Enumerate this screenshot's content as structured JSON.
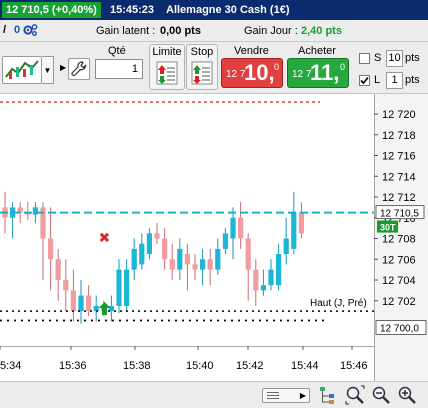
{
  "titlebar": {
    "price_change": "12 710,5 (+0,40%)",
    "time": "15:45:23",
    "instrument": "Allemagne 30 Cash (1€)",
    "colors": {
      "bar": "#0a2c6e",
      "price_pill": "#17a236"
    }
  },
  "infobar": {
    "slash": "/",
    "count": "0",
    "gear_icon": "gears-icon",
    "latent_label": "Gain latent :",
    "latent_value": "0,00 pts",
    "daily_label": "Gain Jour :",
    "daily_value": "2,40 pts",
    "daily_color": "#14a02a"
  },
  "toolbar": {
    "qty_label": "Qté",
    "qty_value": "1",
    "limit_label": "Limite",
    "stop_label": "Stop",
    "sell_label": "Vendre",
    "buy_label": "Acheter",
    "sell_small": "12 7",
    "sell_big": "10,",
    "sell_sup": "0",
    "buy_small": "12 7",
    "buy_big": "11,",
    "buy_sup": "0",
    "s_label": "S",
    "s_pts_value": "10",
    "s_pts_label": "pts",
    "l_label": "L",
    "l_pts_value": "1",
    "l_pts_label": "pts",
    "s_checked": false,
    "l_checked": true
  },
  "chart_data": {
    "type": "candlestick",
    "y_ticks": [
      "12 720",
      "12 718",
      "12 716",
      "12 714",
      "12 712",
      "12 710",
      "12 708",
      "12 706",
      "12 704",
      "12 702"
    ],
    "x_ticks": [
      "5:34",
      "15:36",
      "15:38",
      "15:40",
      "15:42",
      "15:44",
      "15:46"
    ],
    "current_price_label": "12 710,5",
    "timeframe_badge": "30T",
    "lower_price_label": "12 700,0",
    "annotation": "Haut (J, Pré)",
    "ylim": [
      12699.5,
      12721.5
    ],
    "colors": {
      "up": "#1bb6d8",
      "down": "#f09ca0",
      "price_line": "#16b3bf",
      "red_line": "#d42020",
      "badge": "#1a9a2c"
    },
    "levels": {
      "current": 12710.5,
      "red_dashed": 12722,
      "haut_dotted": 12701,
      "lower_dotted": 12700
    },
    "markers": [
      {
        "kind": "sell-x",
        "candle": 16,
        "y": 12708
      },
      {
        "kind": "buy-arrow",
        "candle": 16,
        "y": 12701.3
      }
    ],
    "candles": [
      {
        "o": 12711,
        "h": 12712.5,
        "l": 12708.5,
        "c": 12710
      },
      {
        "o": 12710,
        "h": 12711.5,
        "l": 12708,
        "c": 12711
      },
      {
        "o": 12711,
        "h": 12711.5,
        "l": 12709.5,
        "c": 12710.5
      },
      {
        "o": 12710.5,
        "h": 12711.5,
        "l": 12709.8,
        "c": 12710.3
      },
      {
        "o": 12710.3,
        "h": 12711.5,
        "l": 12709.5,
        "c": 12711
      },
      {
        "o": 12711,
        "h": 12711.5,
        "l": 12704,
        "c": 12708
      },
      {
        "o": 12708,
        "h": 12711,
        "l": 12703,
        "c": 12706
      },
      {
        "o": 12706,
        "h": 12707,
        "l": 12702,
        "c": 12704
      },
      {
        "o": 12704,
        "h": 12706,
        "l": 12701,
        "c": 12703
      },
      {
        "o": 12703,
        "h": 12705,
        "l": 12700,
        "c": 12701
      },
      {
        "o": 12701,
        "h": 12704,
        "l": 12699.8,
        "c": 12702.5
      },
      {
        "o": 12702.5,
        "h": 12703.5,
        "l": 12700.5,
        "c": 12701
      },
      {
        "o": 12701,
        "h": 12702.5,
        "l": 12700,
        "c": 12701.5
      },
      {
        "o": 12701.5,
        "h": 12702,
        "l": 12700.5,
        "c": 12701
      },
      {
        "o": 12701,
        "h": 12702.5,
        "l": 12700,
        "c": 12701.5
      },
      {
        "o": 12701.5,
        "h": 12706,
        "l": 12700.8,
        "c": 12705
      },
      {
        "o": 12701.5,
        "h": 12706,
        "l": 12701,
        "c": 12705
      },
      {
        "o": 12705,
        "h": 12708,
        "l": 12704,
        "c": 12707
      },
      {
        "o": 12705.5,
        "h": 12708.5,
        "l": 12705,
        "c": 12707.5
      },
      {
        "o": 12706.5,
        "h": 12709,
        "l": 12706,
        "c": 12708.5
      },
      {
        "o": 12708.5,
        "h": 12709.5,
        "l": 12707.5,
        "c": 12708
      },
      {
        "o": 12708,
        "h": 12709,
        "l": 12705,
        "c": 12706
      },
      {
        "o": 12706,
        "h": 12707.5,
        "l": 12704,
        "c": 12705
      },
      {
        "o": 12705,
        "h": 12708,
        "l": 12704,
        "c": 12707
      },
      {
        "o": 12706.5,
        "h": 12707.5,
        "l": 12703,
        "c": 12705.5
      },
      {
        "o": 12705.5,
        "h": 12706.5,
        "l": 12704,
        "c": 12705
      },
      {
        "o": 12705,
        "h": 12707,
        "l": 12703.5,
        "c": 12706
      },
      {
        "o": 12706,
        "h": 12707,
        "l": 12703.5,
        "c": 12705
      },
      {
        "o": 12705,
        "h": 12708,
        "l": 12704.5,
        "c": 12707
      },
      {
        "o": 12707,
        "h": 12709,
        "l": 12706.5,
        "c": 12708.5
      },
      {
        "o": 12708,
        "h": 12711,
        "l": 12706,
        "c": 12710
      },
      {
        "o": 12710,
        "h": 12711.5,
        "l": 12707,
        "c": 12708
      },
      {
        "o": 12708,
        "h": 12708.5,
        "l": 12702,
        "c": 12705
      },
      {
        "o": 12705,
        "h": 12706,
        "l": 12701.5,
        "c": 12703
      },
      {
        "o": 12703,
        "h": 12705,
        "l": 12702.5,
        "c": 12703.5
      },
      {
        "o": 12703.5,
        "h": 12706,
        "l": 12703,
        "c": 12705
      },
      {
        "o": 12703.5,
        "h": 12707.5,
        "l": 12703,
        "c": 12706.5
      },
      {
        "o": 12706.5,
        "h": 12710,
        "l": 12705.5,
        "c": 12708
      },
      {
        "o": 12707,
        "h": 12712.5,
        "l": 12706.5,
        "c": 12710.5
      },
      {
        "o": 12710.5,
        "h": 12711.5,
        "l": 12708,
        "c": 12708.5
      }
    ]
  },
  "bottombar": {
    "icons": [
      "tree-icon",
      "zoom-reset-icon",
      "zoom-out-icon",
      "zoom-in-icon"
    ]
  }
}
